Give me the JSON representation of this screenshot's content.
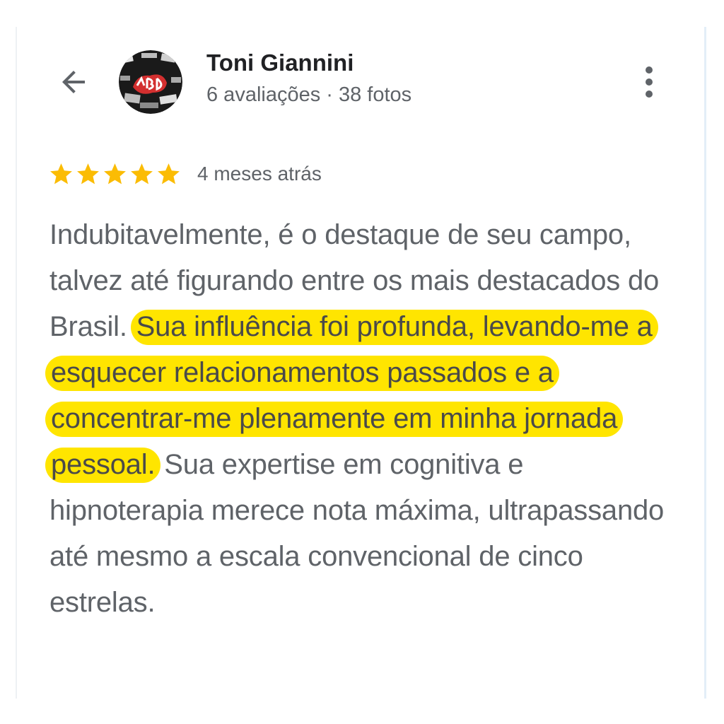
{
  "reviewer": {
    "name": "Toni Giannini",
    "meta": "6 avaliações · 38 fotos",
    "avatar_icon": "profile-photo"
  },
  "header": {
    "back_icon": "arrow-back-icon",
    "more_icon": "more-vert-icon"
  },
  "rating": {
    "stars": 5,
    "max": 5,
    "star_color": "#fbbc04",
    "age": "4 meses atrás"
  },
  "review": {
    "part1": "Indubitavelmente, é o destaque de seu campo, talvez até figurando entre os mais destacados do Brasil. ",
    "highlight": "Sua influência foi profunda, levando-me a esquecer relacionamentos passados e a concentrar-me plenamente em minha jornada pessoal.",
    "part2": " Sua expertise em cognitiva e hipnoterapia merece nota máxima, ultrapassando até mesmo a escala convencional de cinco estrelas.",
    "highlight_color": "#ffe500"
  }
}
